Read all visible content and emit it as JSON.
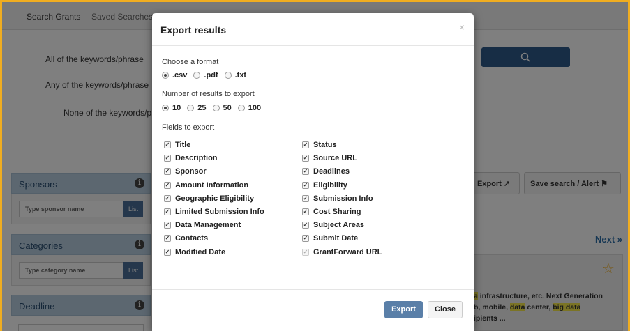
{
  "background": {
    "nav": {
      "search_grants": "Search Grants",
      "saved_searches": "Saved Searches"
    },
    "keywords": {
      "all": "All of the keywords/phrase",
      "any": "Any of the keywords/phrase",
      "none": "None of the keywords/phra"
    },
    "search_icon": "search-icon",
    "panels": {
      "sponsors": {
        "title": "Sponsors",
        "placeholder": "Type sponsor name",
        "list_label": "List"
      },
      "categories": {
        "title": "Categories",
        "placeholder": "Type category name",
        "list_label": "List"
      },
      "deadline": {
        "title": "Deadline"
      }
    },
    "export_button": "Export",
    "save_search_button": "Save search / Alert",
    "next_link": "Next »",
    "snippet": {
      "line1_pre": "a",
      "line1_rest": " infrastructure, etc. Next Generation",
      "line2_pre": "b, mobile, ",
      "line2_hl1": "data",
      "line2_mid": " center, ",
      "line2_hl2": "big data",
      "line3": "ipients ..."
    }
  },
  "modal": {
    "title": "Export results",
    "close_symbol": "×",
    "format_label": "Choose a format",
    "formats": [
      {
        "label": ".csv",
        "selected": true
      },
      {
        "label": ".pdf",
        "selected": false
      },
      {
        "label": ".txt",
        "selected": false
      }
    ],
    "count_label": "Number of results to export",
    "counts": [
      {
        "label": "10",
        "selected": true
      },
      {
        "label": "25",
        "selected": false
      },
      {
        "label": "50",
        "selected": false
      },
      {
        "label": "100",
        "selected": false
      }
    ],
    "fields_label": "Fields to export",
    "fields_left": [
      "Title",
      "Description",
      "Sponsor",
      "Amount Information",
      "Geographic Eligibility",
      "Limited Submission Info",
      "Data Management",
      "Contacts",
      "Modified Date"
    ],
    "fields_right": [
      "Status",
      "Source URL",
      "Deadlines",
      "Eligibility",
      "Submission Info",
      "Cost Sharing",
      "Subject Areas",
      "Submit Date",
      "GrantForward URL"
    ],
    "export_label": "Export",
    "close_label": "Close"
  }
}
